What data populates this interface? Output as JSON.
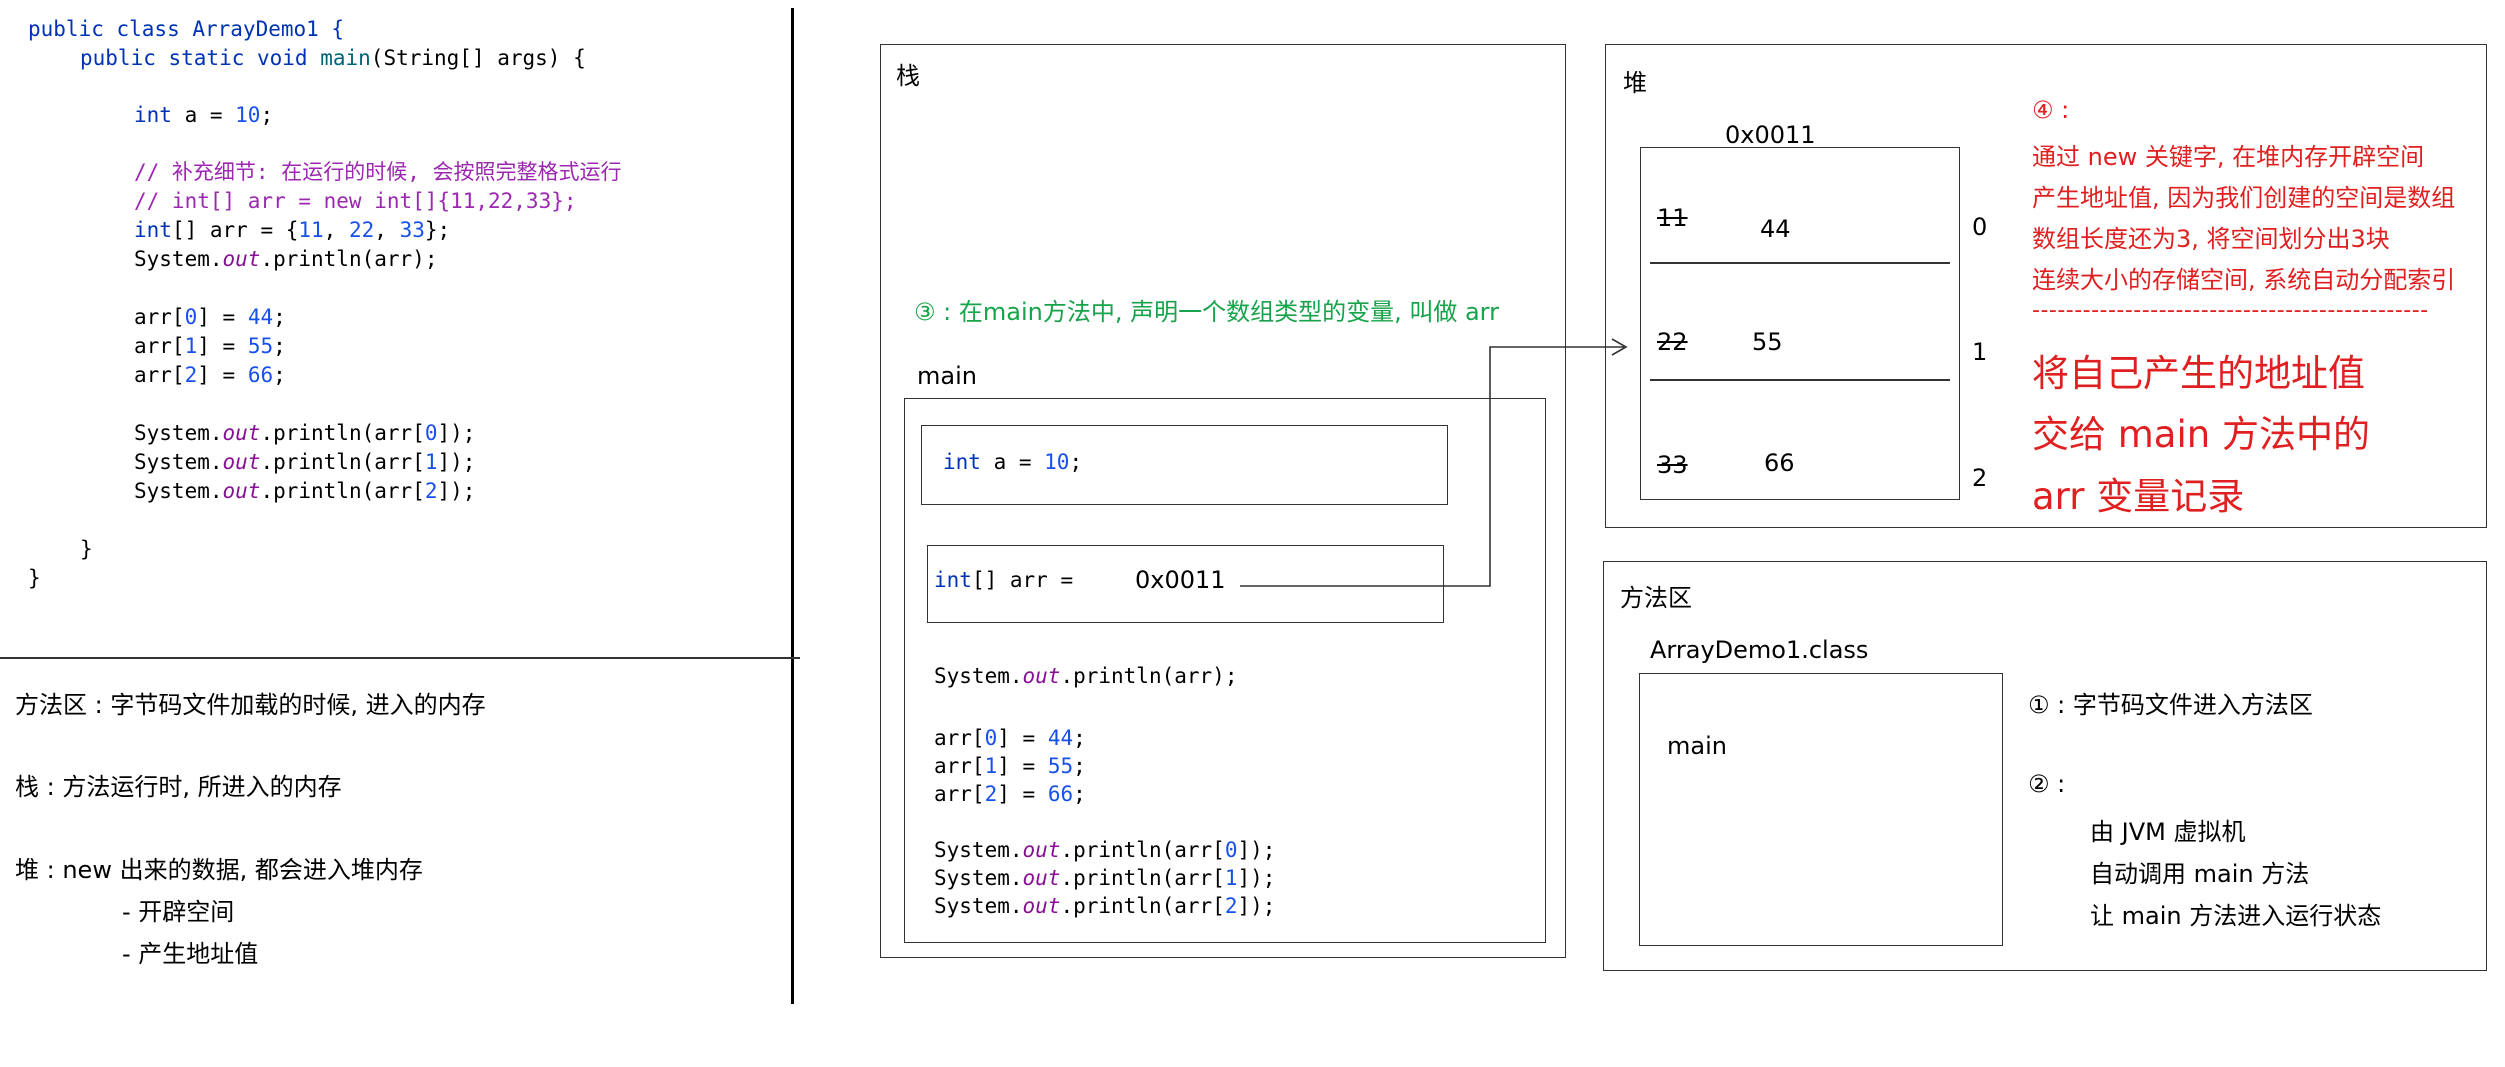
{
  "code": {
    "l1": "public class ArrayDemo1 {",
    "l2a": "public static void ",
    "l2b": "main",
    "l2c": "(String[] args) {",
    "l3a": "int",
    "l3b": " a = ",
    "l3c": "10",
    "l3d": ";",
    "c1": "// 补充细节: 在运行的时候, 会按照完整格式运行",
    "c2": "// int[] arr = new int[]{11,22,33};",
    "l4a": "int",
    "l4b": "[] arr = {",
    "l4c": "11",
    "l4d": ", ",
    "l4e": "22",
    "l4f": ", ",
    "l4g": "33",
    "l4h": "};",
    "print_pre": "System.",
    "print_out": "out",
    "print_arr": ".println(arr);",
    "a0a": "arr[",
    "i0": "0",
    "a0b": "] = ",
    "v44": "44",
    "semi": ";",
    "i1": "1",
    "v55": "55",
    "i2": "2",
    "v66": "66",
    "pa_pre": ".println(arr[",
    "pa_post": "]);",
    "close1": "}",
    "close2": "}"
  },
  "notes": {
    "method_area": "方法区 : 字节码文件加载的时候, 进入的内存",
    "stack": "栈 : 方法运行时, 所进入的内存",
    "heap": "堆 : new 出来的数据, 都会进入堆内存",
    "heap_sub1": "-  开辟空间",
    "heap_sub2": "-  产生地址值"
  },
  "stack_panel": {
    "title": "栈",
    "step3": "③ : 在main方法中, 声明一个数组类型的变量, 叫做 arr",
    "frame_label": "main",
    "var_a_kw": "int",
    "var_a_rest": " a = ",
    "var_a_val": "10",
    "var_a_end": ";",
    "var_arr_kw": "int",
    "var_arr_rest": "[] arr =",
    "var_arr_addr": "0x0011"
  },
  "heap_panel": {
    "title": "堆",
    "address": "0x0011",
    "old_values": [
      "11",
      "22",
      "33"
    ],
    "new_values": [
      "44",
      "55",
      "66"
    ],
    "indices": [
      "0",
      "1",
      "2"
    ],
    "step4_title": "④ :",
    "step4_lines": [
      "通过 new 关键字, 在堆内存开辟空间",
      "产生地址值, 因为我们创建的空间是数组",
      "数组长度还为3, 将空间划分出3块",
      "连续大小的存储空间, 系统自动分配索引"
    ],
    "dashes": "-----------------------------------------------",
    "big_lines": [
      "将自己产生的地址值",
      "交给 main 方法中的",
      "arr 变量记录"
    ]
  },
  "method_panel": {
    "title": "方法区",
    "class_name": "ArrayDemo1.class",
    "method": "main",
    "step1": "① : 字节码文件进入方法区",
    "step2": "② :",
    "step2_lines": [
      "由 JVM 虚拟机",
      "自动调用 main 方法",
      "让 main 方法进入运行状态"
    ]
  },
  "colors": {
    "red": "#e02020",
    "green": "#17a34a",
    "keyword": "#0033b3",
    "number": "#1750eb",
    "comment": "#9c27b0",
    "field": "#871094"
  }
}
